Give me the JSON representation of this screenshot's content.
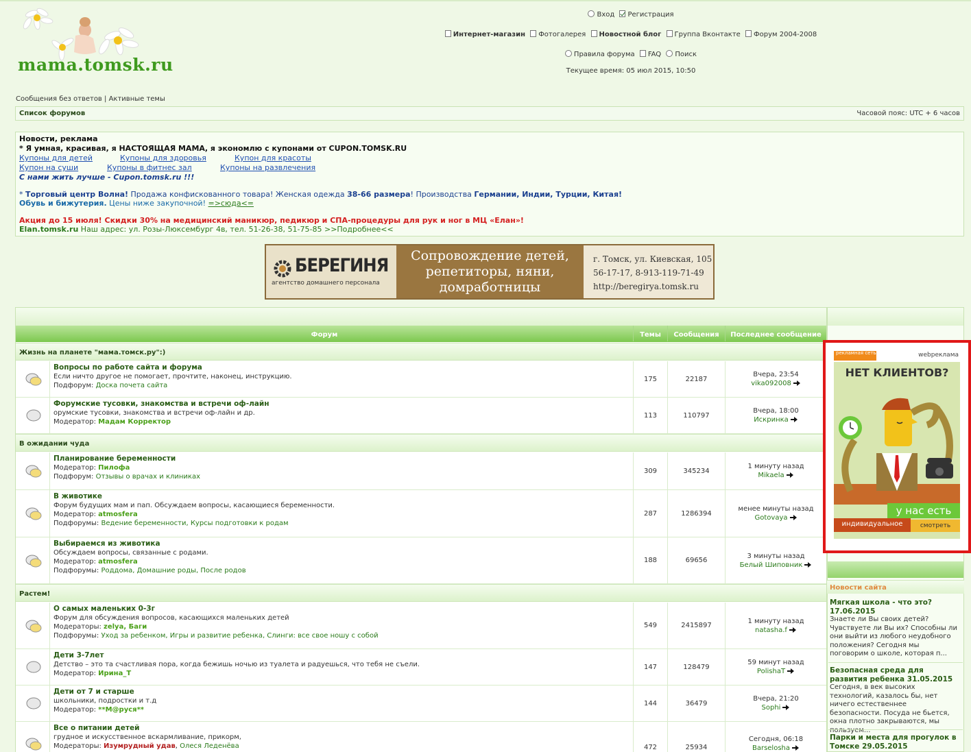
{
  "header": {
    "site_name": "mama.tomsk.ru",
    "nav_row1": {
      "login": "Вход",
      "register": "Регистрация"
    },
    "nav_row2": {
      "shop": "Интернет-магазин",
      "gallery": "Фотогалерея",
      "blog": "Новостной блог",
      "vk": "Группа Вконтакте",
      "forum_old": "Форум 2004-2008"
    },
    "nav_row3": {
      "rules": "Правила форума",
      "faq": "FAQ",
      "search": "Поиск"
    },
    "current_time": "Текущее время: 05 июл 2015, 10:50"
  },
  "quicklinks": {
    "unanswered": "Сообщения без ответов",
    "sep": "|",
    "active": "Активные темы"
  },
  "breadcrumb": {
    "label": "Список форумов",
    "timezone": "Часовой пояс: UTC + 6 часов"
  },
  "news": {
    "title": "Новости, реклама",
    "line1": "* Я умная, красивая, я НАСТОЯЩАЯ МАМА, я экономлю с купонами от CUPON.TOMSK.RU",
    "links1": [
      "Купоны для детей",
      "Купоны для здоровья",
      "Купон для красоты"
    ],
    "links2": [
      "Купон на суши",
      "Купоны в фитнес зал",
      "Купоны на развлечения"
    ],
    "slogan": "С нами жить лучше - Cupon.tomsk.ru !!!",
    "volna": {
      "star": "* ",
      "name": "Торговый центр Волна!",
      "t1": " Продажа конфискованного товара! Женская одежда ",
      "sizes": "38-66 размера",
      "t2": "! Производства ",
      "countries": "Германии, Индии, Турции, Китая!",
      "shoes": "Обувь и бижутерия.",
      "t3": " Цены ниже закупочной! ",
      "here": "=>сюда<="
    },
    "elan": {
      "promo": "Акция до 15 июля! Скидки 30% на медицинский маникюр, педикюр и СПА-процедуры для рук и ног в МЦ «Елан»!",
      "site": "Elan.tomsk.ru",
      "address": " Наш адрес: ул. Розы-Люксембург 4в, тел. 51-26-38, 51-75-85 >>Подробнее<<"
    }
  },
  "banner": {
    "brand": "БЕРЕГИНЯ",
    "brand_sub": "агентство домашнего персонала",
    "mid": [
      "Сопровождение детей,",
      "репетиторы, няни,",
      "домработницы"
    ],
    "right": [
      "г. Томск, ул. Киевская, 105",
      "56-17-17, 8-913-119-71-49",
      "http://beregirya.tomsk.ru"
    ]
  },
  "table_headers": {
    "forum": "Форум",
    "topics": "Темы",
    "posts": "Сообщения",
    "last": "Последнее сообщение"
  },
  "categories": [
    {
      "name": "Жизнь на планете \"мама.томск.ру\":)"
    },
    {
      "name": "В ожидании чуда"
    },
    {
      "name": "Растем!"
    }
  ],
  "forums": [
    {
      "title": "Вопросы по работе сайта и форума",
      "desc": "Если ничто другое не помогает, прочтите, наконец, инструкцию.",
      "sublabel": "Подфорум:",
      "subs": "Доска почета сайта",
      "topics": "175",
      "posts": "22187",
      "last_time": "Вчера, 23:54",
      "last_user": "vika092008"
    },
    {
      "title": "Форумские тусовки, знакомства и встречи оф-лайн",
      "desc": "орумские тусовки, знакомства и встречи оф-лайн и др.",
      "modlabel": "Модератор:",
      "mods": "Мадам Корректор",
      "topics": "113",
      "posts": "110797",
      "last_time": "Вчера, 18:00",
      "last_user": "Искринка"
    },
    {
      "title": "Планирование беременности",
      "modlabel": "Модератор:",
      "mods": "Пилофа",
      "sublabel": "Подфорум:",
      "subs": "Отзывы о врачах и клиниках",
      "topics": "309",
      "posts": "345234",
      "last_time": "1 минуту назад",
      "last_user": "Mikaela"
    },
    {
      "title": "В животике",
      "desc": "Форум будущих мам и пап. Обсуждаем вопросы, касающиеся беременности.",
      "modlabel": "Модератор:",
      "mods": "atmosfera",
      "sublabel": "Подфорумы:",
      "subs": "Ведение беременности, Курсы подготовки к родам",
      "topics": "287",
      "posts": "1286394",
      "last_time": "менее минуты назад",
      "last_user": "Gotovaya"
    },
    {
      "title": "Выбираемся из животика",
      "desc": "Обсуждаем вопросы, связанные с родами.",
      "modlabel": "Модератор:",
      "mods": "atmosfera",
      "sublabel": "Подфорумы:",
      "subs": "Роддома, Домашние роды, После родов",
      "topics": "188",
      "posts": "69656",
      "last_time": "3 минуты назад",
      "last_user": "Белый Шиповник"
    },
    {
      "title": "О самых маленьких 0-3г",
      "desc": "Форум для обсуждения вопросов, касающихся маленьких детей",
      "modlabel": "Модераторы:",
      "mods": "zelya, Баги",
      "sublabel": "Подфорумы:",
      "subs": "Уход за ребенком, Игры и развитие ребенка, Слинги: все свое ношу с собой",
      "topics": "549",
      "posts": "2415897",
      "last_time": "1 минуту назад",
      "last_user": "natasha.f"
    },
    {
      "title": "Дети 3-7лет",
      "desc": "Детство – это та счастливая пора, когда бежишь ночью из туалета и радуешься, что тебя не съели.",
      "modlabel": "Модератор:",
      "mods": "Ирина_Т",
      "topics": "147",
      "posts": "128479",
      "last_time": "59 минут назад",
      "last_user": "PolishaT"
    },
    {
      "title": "Дети от 7 и старше",
      "desc": "школьники, подростки и т.д",
      "modlabel": "Модератор:",
      "mods": "**М@руся**",
      "topics": "144",
      "posts": "36479",
      "last_time": "Вчера, 21:20",
      "last_user": "Sophi"
    },
    {
      "title": "Все о питании детей",
      "desc": "грудное и искусственное вскармливание, прикорм,",
      "modlabel": "Модераторы:",
      "mods_red": "Изумрудный удав",
      "mods_sep": ", ",
      "mods_plain": "Олеся Леденёва",
      "topics": "472",
      "posts": "25934",
      "last_time": "Сегодня, 06:18",
      "last_user": "Barselosha"
    }
  ],
  "ad": {
    "tag": "рекламная сеть",
    "brand": "webреклама",
    "headline": "НЕТ КЛИЕНТОВ?",
    "yes": "у нас есть",
    "individual": "индивидуальное",
    "look": "смотреть"
  },
  "site_news": {
    "title": "Новости сайта",
    "items": [
      {
        "title": "Мягкая школа - что это? 17.06.2015",
        "text": "Знаете ли Вы своих детей? Чувствуете ли Вы их? Способны ли они выйти из любого неудобного положения? Сегодня мы поговорим о школе, которая п..."
      },
      {
        "title": "Безопасная среда для развития ребенка 31.05.2015",
        "text": "Сегодня, в век высоких технологий, казалось бы, нет ничего естественнее безопасности. Посуда не бьется, окна плотно закрываются, мы пользуем..."
      },
      {
        "title": "Парки и места для прогулок в Томске 29.05.2015",
        "text": ""
      }
    ]
  },
  "colors": {
    "bg": "#eff8e6",
    "header_green": "#8fcf6a",
    "title_green": "#2a5d15",
    "ad_border": "#e01818"
  }
}
